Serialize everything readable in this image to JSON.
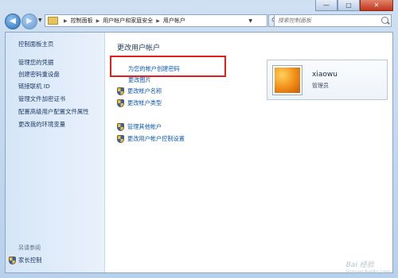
{
  "window": {
    "controls": [
      "—",
      "▢",
      "✕"
    ]
  },
  "address": {
    "path": [
      "控制面板",
      "用户帐户和家庭安全",
      "用户帐户"
    ],
    "search_placeholder": "搜索控制面板"
  },
  "sidebar": {
    "items": [
      {
        "label": "控制面板主页"
      },
      {
        "label": "管理您的凭据"
      },
      {
        "label": "创建密码重设盘"
      },
      {
        "label": "链接联机 ID"
      },
      {
        "label": "管理文件加密证书"
      },
      {
        "label": "配置高级用户配置文件属性"
      },
      {
        "label": "更改我的环境变量"
      }
    ],
    "see_also": "另请参阅",
    "parental": "家长控制"
  },
  "main": {
    "title": "更改用户帐户",
    "tasks": [
      {
        "label": "为您的帐户创建密码"
      },
      {
        "label": "更改图片"
      },
      {
        "label": "更改帐户名称"
      },
      {
        "label": "更改帐户类型"
      },
      {
        "label": "管理其他帐户"
      },
      {
        "label": "更改用户帐户控制设置"
      }
    ]
  },
  "user": {
    "name": "xiaowu",
    "role": "管理员"
  },
  "watermark": {
    "text": "Bai 经验",
    "sub": "jingyan.baidu.com"
  }
}
